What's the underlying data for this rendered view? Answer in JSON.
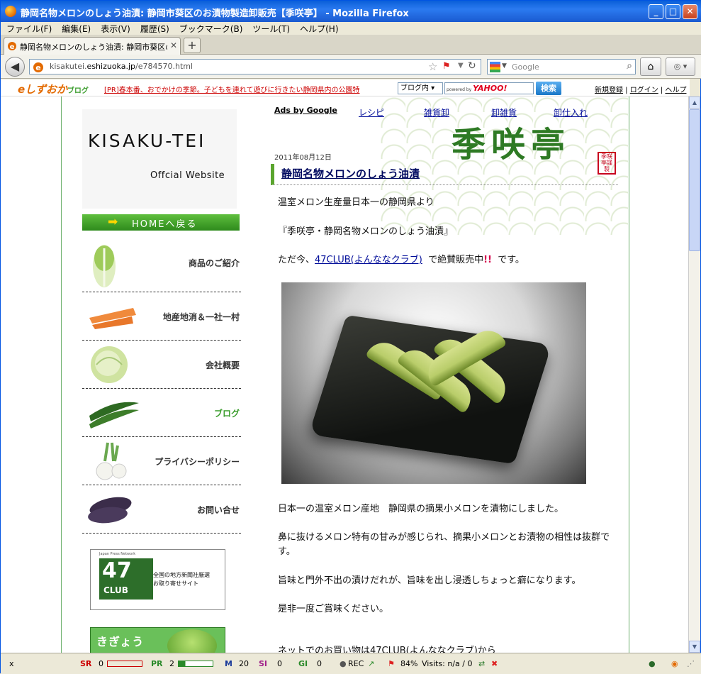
{
  "window": {
    "title": "静岡名物メロンのしょう油漬: 静岡市葵区のお漬物製造卸販売【季咲亭】 - Mozilla Firefox"
  },
  "menu": [
    "ファイル(F)",
    "編集(E)",
    "表示(V)",
    "履歴(S)",
    "ブックマーク(B)",
    "ツール(T)",
    "ヘルプ(H)"
  ],
  "tab": {
    "label": "静岡名物メロンのしょう油漬: 静岡市葵区のお..."
  },
  "nav": {
    "url_prefix": "kisakutei.",
    "url_domain": "eshizuoka.jp",
    "url_suffix": "/e784570.html",
    "search_placeholder": "Google"
  },
  "blogbar": {
    "logo": "eしずおか",
    "logo_sub": "ブログ",
    "pr": "[PR]春本番、おでかけの季節。子どもを連れて遊びに行きたい静岡県内の公園特",
    "scope": "ブログ内",
    "yahoo_powered": "powered by",
    "yahoo": "YAHOO!",
    "search_btn": "検索",
    "register": "新規登録",
    "login": "ログイン",
    "help": "ヘルプ"
  },
  "sidebar": {
    "brand_name": "KISAKU-TEI",
    "brand_sub": "Offcial Website",
    "home": "HOMEへ戻る",
    "items": [
      {
        "label": "商品のご紹介"
      },
      {
        "label": "地産地消＆一社一村"
      },
      {
        "label": "会社概要"
      },
      {
        "label": "ブログ"
      },
      {
        "label": "プライバシーポリシー"
      },
      {
        "label": "お問い合せ"
      }
    ],
    "banner47": {
      "network": "Japan Press Network",
      "num": "47",
      "club": "CLUB",
      "desc1": "全国の地方新聞社厳選",
      "desc2": "お取り寄せサイト"
    },
    "banner2": {
      "text": "きぎょう"
    }
  },
  "ads": {
    "title": "Ads by Google",
    "links": [
      "レシピ",
      "雑貨卸",
      "卸雑貨",
      "卸仕入れ"
    ]
  },
  "logo": {
    "kanji": "季咲亭",
    "seal": "季咲亭謹製"
  },
  "post": {
    "date": "2011年08月12日",
    "title": "静岡名物メロンのしょう油漬",
    "p1": "温室メロン生産量日本一の静岡県より",
    "p2": "『季咲亭・静岡名物メロンのしょう油漬』",
    "p3a": "ただ今、",
    "p3link": "47CLUB(よんななクラブ)",
    "p3b": "で絶賛販売中",
    "p3ex": "!!",
    "p3c": "です。",
    "p4": "日本一の温室メロン産地　静岡県の摘果小メロンを漬物にしました。",
    "p5": "鼻に抜けるメロン特有の甘みが感じられ、摘果小メロンとお漬物の相性は抜群です。",
    "p6": "旨味と門外不出の漬けだれが、旨味を出し浸透しちょっと癖になります。",
    "p7": "是非一度ご賞味ください。",
    "p8": "ネットでのお買い物は47CLUB(よんななクラブ)から"
  },
  "status": {
    "close": "x",
    "sr": "SR",
    "sr_val": "0",
    "pr": "PR",
    "pr_val": "2",
    "m": "M",
    "m_val": "20",
    "si": "SI",
    "si_val": "0",
    "gi": "GI",
    "gi_val": "0",
    "rec": "REC",
    "zoom": "84%",
    "visits": "Visits: n/a / 0"
  }
}
